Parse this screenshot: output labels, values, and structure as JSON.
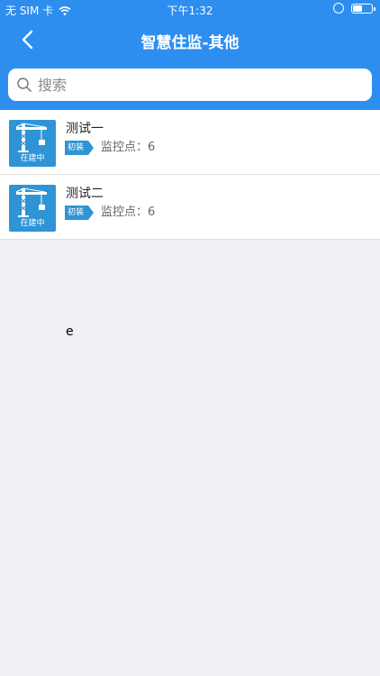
{
  "status_bar": {
    "carrier": "无 SIM 卡",
    "time": "下午1:32",
    "battery_level": 0.55
  },
  "nav": {
    "title": "智慧住监-其他",
    "back_icon": "chevron-left-icon"
  },
  "search": {
    "placeholder": "搜索",
    "value": ""
  },
  "items": [
    {
      "title": "测试一",
      "status": "在建中",
      "tag": "初装",
      "monitor_label": "监控点：",
      "monitor_count": "6"
    },
    {
      "title": "测试二",
      "status": "在建中",
      "tag": "初装",
      "monitor_label": "监控点：",
      "monitor_count": "6"
    }
  ],
  "stray_text": "e",
  "colors": {
    "primary": "#2d8ef0",
    "thumb": "#2f94d5",
    "background": "#efeff4"
  }
}
